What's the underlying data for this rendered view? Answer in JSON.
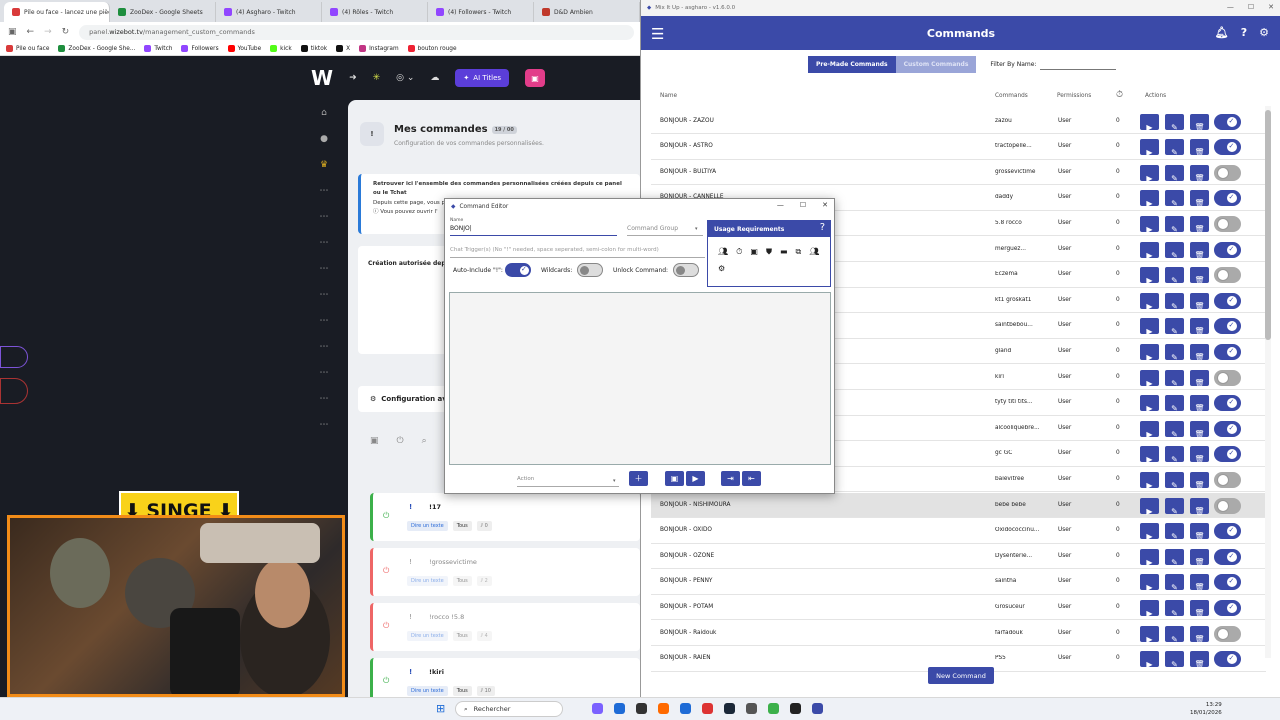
{
  "browser": {
    "tabs": [
      {
        "label": "Pile ou face - lancez une pièce ×",
        "color": "#d93a3a"
      },
      {
        "label": "ZooDex - Google Sheets",
        "color": "#1e8e3e"
      },
      {
        "label": "(4) Asgharo - Twitch",
        "color": "#9146ff"
      },
      {
        "label": "(4) Rôles - Twitch",
        "color": "#9146ff"
      },
      {
        "label": "(4) Followers - Twitch",
        "color": "#9146ff"
      },
      {
        "label": "D&D Ambien",
        "color": "#c0392b"
      }
    ],
    "url_prefix": "panel.",
    "url_domain": "wizebot.tv",
    "url_path": "/management_custom_commands",
    "bookmarks": [
      "Pile ou face",
      "ZooDex - Google She...",
      "Twitch",
      "Followers",
      "YouTube",
      "kick",
      "tiktok",
      "X",
      "Instagram",
      "bouton rouge"
    ]
  },
  "wizebot": {
    "ai_titles": "AI Titles",
    "page_title": "Mes commandes",
    "count_chip": "19 / 00",
    "page_subtitle": "Configuration de vos commandes personnalisées.",
    "info_line1": "Retrouver ici l'ensemble des commandes personnalisées créées depuis ce panel ou le Tchat",
    "info_line2": "Depuis cette page, vous p... ... les dépacts... et les a... ...",
    "info_line3": "Vous pouvez ouvrir l'",
    "creation_label": "Création autorisée depuis",
    "config_title": "Configuration avan",
    "commands": [
      {
        "name": "!17",
        "enabled": true,
        "tag1": "Dire un texte",
        "tag2": "Tous",
        "count": "0"
      },
      {
        "name": "!grossevictime",
        "enabled": false,
        "tag1": "Dire un texte",
        "tag2": "Tous",
        "count": "2"
      },
      {
        "name": "!rocco !5.8",
        "enabled": false,
        "tag1": "Dire un texte",
        "tag2": "Tous",
        "count": "4"
      },
      {
        "name": "!kiri",
        "enabled": true,
        "tag1": "Dire un texte",
        "tag2": "Tous",
        "count": "10"
      }
    ]
  },
  "overlay": {
    "banner": "SINGE"
  },
  "taskbar": {
    "search": "Rechercher",
    "time": "13:29",
    "date": "18/01/2026"
  },
  "mixitup": {
    "window_title": "Mix It Up - asgharo - v1.6.0.0",
    "header_title": "Commands",
    "premade_btn": "Pre-Made Commands",
    "custom_btn": "Custom Commands",
    "filter_label": "Filter By Name:",
    "columns": {
      "name": "Name",
      "commands": "Commands",
      "permissions": "Permissions",
      "actions": "Actions"
    },
    "rows": [
      {
        "name": "BONJOUR - ZAZOU",
        "cmd": "zazou",
        "perm": "User",
        "cd": "0",
        "on": true
      },
      {
        "name": "BONJOUR - ASTRO",
        "cmd": "tractopelle...",
        "perm": "User",
        "cd": "0",
        "on": true
      },
      {
        "name": "BONJOUR - BULTIYA",
        "cmd": "grossevictime",
        "perm": "User",
        "cd": "0",
        "on": false
      },
      {
        "name": "BONJOUR - CANNELLE",
        "cmd": "daddy",
        "perm": "User",
        "cd": "0",
        "on": true
      },
      {
        "name": "",
        "cmd": "5.8 rocco",
        "perm": "User",
        "cd": "0",
        "on": false
      },
      {
        "name": "",
        "cmd": "merguez...",
        "perm": "User",
        "cd": "0",
        "on": true
      },
      {
        "name": "",
        "cmd": "Eczema",
        "perm": "User",
        "cd": "0",
        "on": false
      },
      {
        "name": "",
        "cmd": "kt1 groskat1",
        "perm": "User",
        "cd": "0",
        "on": true
      },
      {
        "name": "",
        "cmd": "saintbébou...",
        "perm": "User",
        "cd": "0",
        "on": true
      },
      {
        "name": "",
        "cmd": "gland",
        "perm": "User",
        "cd": "0",
        "on": true
      },
      {
        "name": "",
        "cmd": "kiri",
        "perm": "User",
        "cd": "0",
        "on": false
      },
      {
        "name": "",
        "cmd": "tyty titi tits...",
        "perm": "User",
        "cd": "0",
        "on": true
      },
      {
        "name": "",
        "cmd": "alcooliquebre...",
        "perm": "User",
        "cd": "0",
        "on": true
      },
      {
        "name": "",
        "cmd": "gc GC",
        "perm": "User",
        "cd": "0",
        "on": true
      },
      {
        "name": "",
        "cmd": "baievitree",
        "perm": "User",
        "cd": "0",
        "on": false
      },
      {
        "name": "BONJOUR - NISHIMOURA",
        "cmd": "bebe bébé",
        "perm": "User",
        "cd": "0",
        "on": false
      },
      {
        "name": "BONJOUR - OXIDO",
        "cmd": "Oxidococcinu...",
        "perm": "User",
        "cd": "0",
        "on": true
      },
      {
        "name": "BONJOUR - OZONE",
        "cmd": "Dysenterie...",
        "perm": "User",
        "cd": "0",
        "on": true
      },
      {
        "name": "BONJOUR - PENNY",
        "cmd": "saintha",
        "perm": "User",
        "cd": "0",
        "on": true
      },
      {
        "name": "BONJOUR - POTAM",
        "cmd": "Grosuceur",
        "perm": "User",
        "cd": "0",
        "on": true
      },
      {
        "name": "BONJOUR - Raidouk",
        "cmd": "farfadouk",
        "perm": "User",
        "cd": "0",
        "on": false
      },
      {
        "name": "BONJOUR - RAIEN",
        "cmd": "PS5",
        "perm": "User",
        "cd": "0",
        "on": true
      }
    ],
    "new_command": "New Command"
  },
  "editor": {
    "title": "Command Editor",
    "name_label": "Name",
    "name_value": "BONJO",
    "command_group_placeholder": "Command Group",
    "trigger_placeholder": "Chat Trigger(s) (No \"!\" needed, space seperated, semi-colon for multi-word)",
    "auto_include_label": "Auto-Include \"!\":",
    "wildcards_label": "Wildcards:",
    "unlock_label": "Unlock Command:",
    "usage_title": "Usage Requirements",
    "action_placeholder": "Action"
  }
}
